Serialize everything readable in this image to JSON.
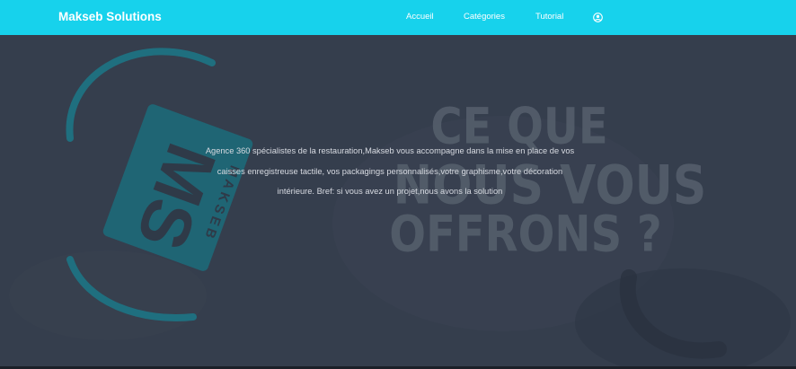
{
  "navbar": {
    "brand": "Makseb Solutions",
    "links": [
      "Accueil",
      "Catégories",
      "Tutorial"
    ],
    "user_icon": "user-circle-icon",
    "color": "#17d2ec"
  },
  "hero": {
    "background_color": "#353e4d",
    "logo_letters": "MS",
    "logo_word": "MAKSEB",
    "heading_lines": [
      "CE QUE",
      "NOUS VOUS",
      "OFFRONS ?"
    ],
    "text": "Agence 360 spécialistes de la restauration,Makseb vous accompagne dans la mise en place de vos caisses enregistreuse tactile, vos packagings personnalisés,votre graphisme,votre décoration intérieure. Bref: si vous avez un projet,nous avons la solution"
  }
}
